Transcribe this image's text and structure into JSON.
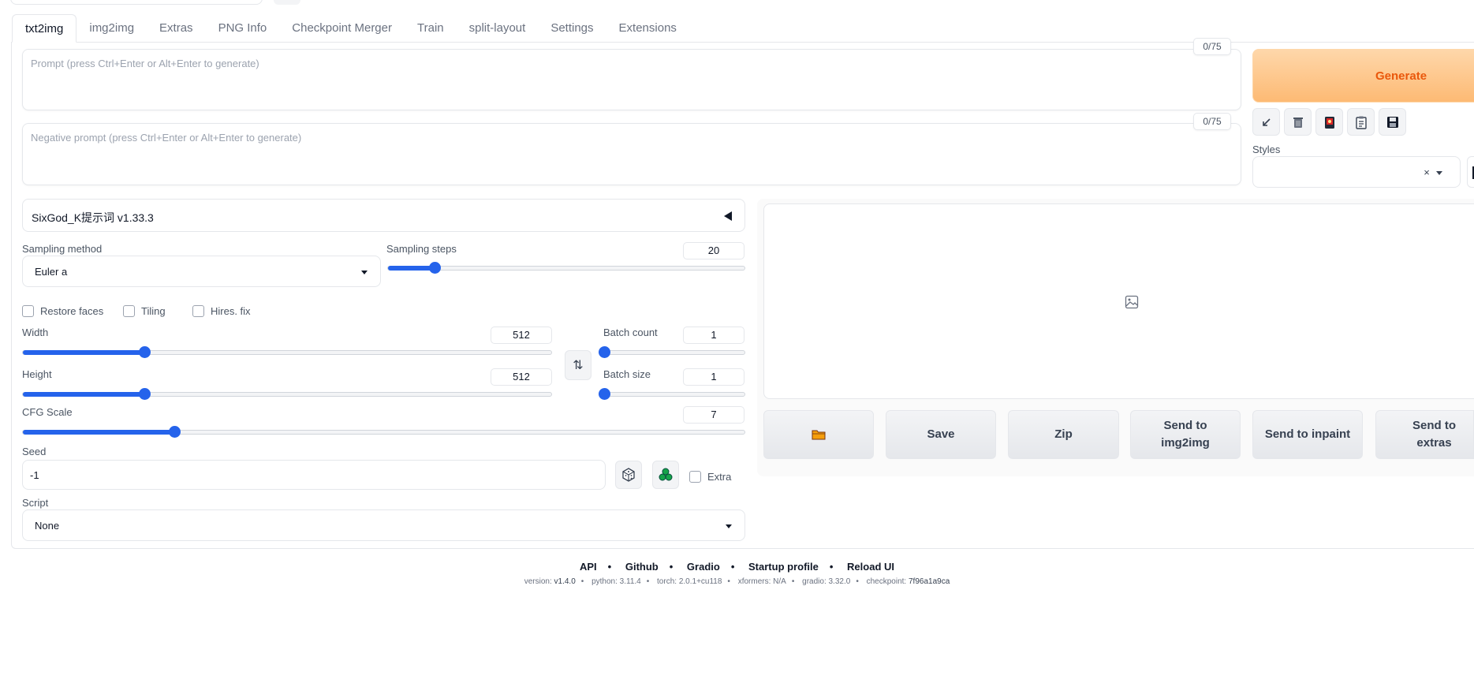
{
  "tabs": [
    "txt2img",
    "img2img",
    "Extras",
    "PNG Info",
    "Checkpoint Merger",
    "Train",
    "split-layout",
    "Settings",
    "Extensions"
  ],
  "prompt": {
    "placeholder": "Prompt (press Ctrl+Enter or Alt+Enter to generate)",
    "token_count": "0/75"
  },
  "negative_prompt": {
    "placeholder": "Negative prompt (press Ctrl+Enter or Alt+Enter to generate)",
    "token_count": "0/75"
  },
  "generate_label": "Generate",
  "tool_icons": [
    "arrow-icon",
    "trash-icon",
    "card-icon",
    "clipboard-icon",
    "save-icon"
  ],
  "styles_label": "Styles",
  "styles_clear": "×",
  "extension_accordion": "SixGod_K提示词 v1.33.3",
  "sampling_method": {
    "label": "Sampling method",
    "value": "Euler a"
  },
  "sampling_steps": {
    "label": "Sampling steps",
    "value": "20",
    "fraction": 0.13
  },
  "checkboxes": {
    "restore_faces": "Restore faces",
    "tiling": "Tiling",
    "hires_fix": "Hires. fix"
  },
  "width": {
    "label": "Width",
    "value": "512",
    "fraction": 0.23
  },
  "height": {
    "label": "Height",
    "value": "512",
    "fraction": 0.23
  },
  "swap_icon": "⇅",
  "batch_count": {
    "label": "Batch count",
    "value": "1",
    "fraction": 0.0
  },
  "batch_size": {
    "label": "Batch size",
    "value": "1",
    "fraction": 0.0
  },
  "cfg_scale": {
    "label": "CFG Scale",
    "value": "7",
    "fraction": 0.21
  },
  "seed": {
    "label": "Seed",
    "value": "-1",
    "extra_label": "Extra"
  },
  "script": {
    "label": "Script",
    "value": "None"
  },
  "output_buttons": {
    "folder_icon": "folder-icon",
    "save": "Save",
    "zip": "Zip",
    "send_img2img": "Send to img2img",
    "send_inpaint": "Send to inpaint",
    "send_extras": "Send to extras"
  },
  "footer": {
    "links": [
      "API",
      "Github",
      "Gradio",
      "Startup profile",
      "Reload UI"
    ],
    "version_label": "version:",
    "version": "v1.4.0",
    "python_label": "python:",
    "python": "3.11.4",
    "torch_label": "torch:",
    "torch": "2.0.1+cu118",
    "xformers_label": "xformers:",
    "xformers": "N/A",
    "gradio_label": "gradio:",
    "gradio": "3.32.0",
    "checkpoint_label": "checkpoint:",
    "checkpoint": "7f96a1a9ca"
  },
  "colors": {
    "accent": "#2563eb",
    "generate_bg": "#fdba74",
    "generate_text": "#ea580c"
  }
}
